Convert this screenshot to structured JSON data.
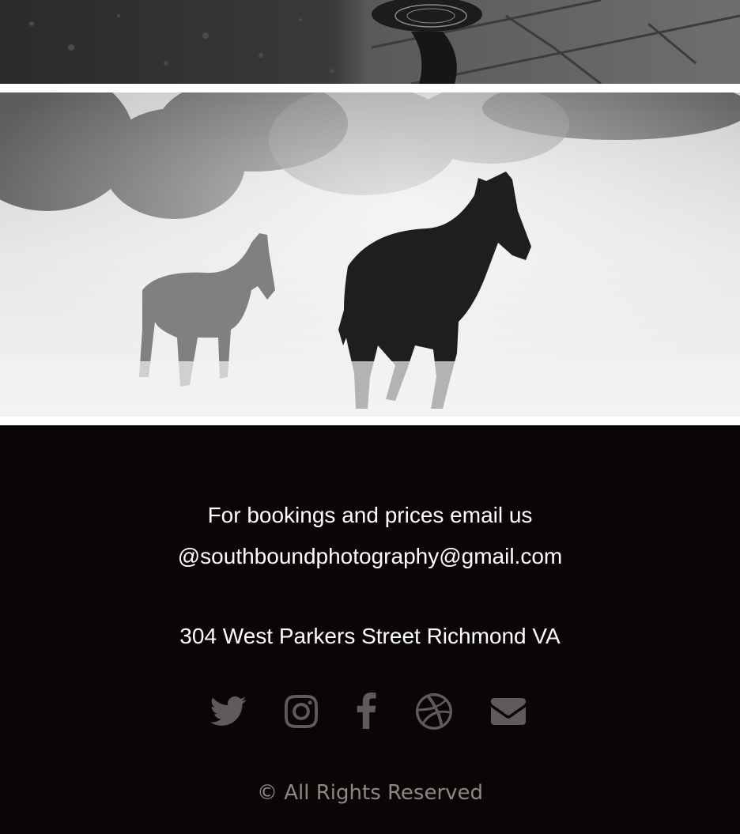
{
  "gallery": {
    "photos": [
      {
        "name": "street-reflection-photo",
        "tone": "grayscale"
      },
      {
        "name": "horses-running-in-dust-photo",
        "tone": "grayscale"
      }
    ]
  },
  "footer": {
    "booking_line1": "For bookings and prices email us",
    "booking_line2": "@southboundphotography@gmail.com",
    "address": "304 West Parkers Street Richmond VA",
    "social": [
      {
        "icon": "twitter-icon"
      },
      {
        "icon": "instagram-icon"
      },
      {
        "icon": "facebook-icon"
      },
      {
        "icon": "dribbble-icon"
      },
      {
        "icon": "envelope-icon"
      }
    ],
    "copyright": "© All Rights Reserved",
    "colors": {
      "background": "#0a0605",
      "text": "#ffffff",
      "icons": "#5f5b5a",
      "copyright": "#8c8886"
    }
  }
}
